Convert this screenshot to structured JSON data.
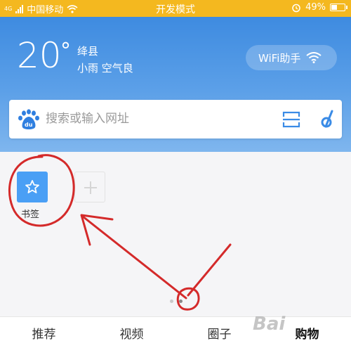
{
  "status_bar": {
    "signal_text": "4G",
    "carrier": "中国移动",
    "mode": "开发模式",
    "battery_percent": "49%",
    "battery_level": 0.49
  },
  "weather": {
    "temperature": "20",
    "degree_symbol": "°",
    "city": "绛县",
    "condition": "小雨 空气良"
  },
  "wifi_assistant": {
    "label": "WiFi助手"
  },
  "search": {
    "placeholder": "搜索或输入网址"
  },
  "shortcuts": [
    {
      "label": "书签",
      "icon": "star-icon"
    },
    {
      "label": "",
      "icon": "plus-icon"
    }
  ],
  "page_indicator": {
    "count": 2,
    "active": 1
  },
  "tabs": [
    {
      "label": "推荐"
    },
    {
      "label": "视频"
    },
    {
      "label": "圈子"
    },
    {
      "label": "购物"
    }
  ],
  "watermark": "Bai",
  "colors": {
    "status_bar": "#f4b81f",
    "header_top": "#3e8be0",
    "accent_blue": "#4a9ff5",
    "annotation_red": "#d42a2a"
  }
}
